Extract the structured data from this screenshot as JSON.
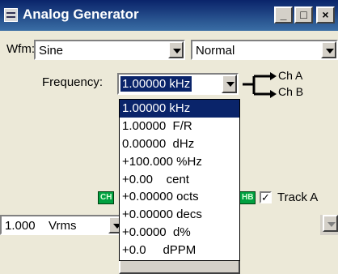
{
  "window": {
    "title": "Analog Generator",
    "minimize": "_",
    "maximize": "□",
    "close": "×"
  },
  "waveform": {
    "label": "Wfm:",
    "value": "Sine",
    "mode": "Normal"
  },
  "frequency": {
    "label": "Frequency:",
    "value": "1.00000 kHz",
    "channels": [
      "Ch A",
      "Ch B"
    ],
    "options": [
      "1.00000 kHz",
      "1.00000  F/R",
      "0.00000  dHz",
      "+100.000 %Hz",
      "+0.00    cent",
      "+0.00000 octs",
      "+0.00000 decs",
      "+0.0000  d%",
      "+0.0     dPPM"
    ]
  },
  "amplitude": {
    "value": "1.000",
    "unit": "Vrms"
  },
  "tags": {
    "ch_left": "CH",
    "ch_right": "HB"
  },
  "track": {
    "label": "Track A",
    "checked": "✓"
  }
}
